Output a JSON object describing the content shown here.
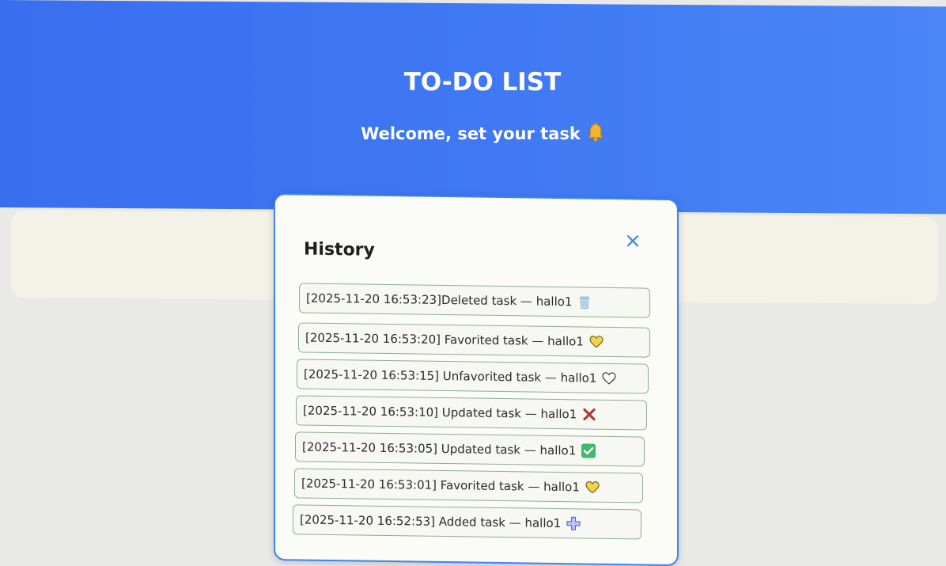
{
  "header": {
    "title": "TO-DO LIST",
    "welcome": "Welcome, set your task"
  },
  "history": {
    "title": "History",
    "items": [
      {
        "text": "[2025-11-20 16:53:23]Deleted task — hallo1",
        "icon": "trash-icon"
      },
      {
        "text": "[2025-11-20 16:53:20] Favorited task — hallo1",
        "icon": "yellow-heart-icon"
      },
      {
        "text": "[2025-11-20 16:53:15] Unfavorited task — hallo1",
        "icon": "white-heart-icon"
      },
      {
        "text": "[2025-11-20 16:53:10] Updated task — hallo1",
        "icon": "cross-mark-icon"
      },
      {
        "text": "[2025-11-20 16:53:05] Updated task — hallo1",
        "icon": "check-mark-icon"
      },
      {
        "text": "[2025-11-20 16:53:01] Favorited task — hallo1",
        "icon": "yellow-heart-icon"
      },
      {
        "text": "[2025-11-20 16:52:53] Added task — hallo1",
        "icon": "plus-icon"
      }
    ]
  },
  "colors": {
    "header_blue": "#3f78f3",
    "modal_border": "#3d86ea",
    "item_border": "#8fae8f",
    "heart_yellow": "#f1d44c",
    "check_green": "#3fb86b",
    "cross_red": "#b23a3a"
  }
}
